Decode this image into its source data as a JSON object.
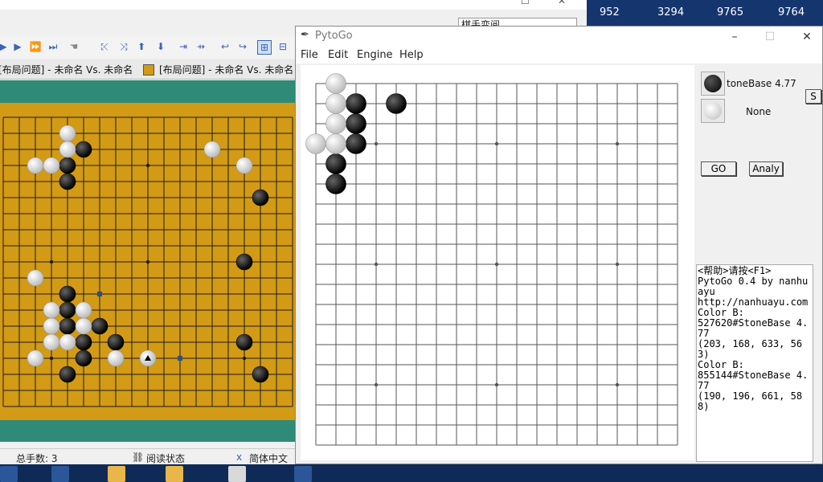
{
  "desktop": {
    "counters": [
      "952",
      "3294",
      "9765",
      "9764"
    ]
  },
  "bg_app": {
    "combo_value": "棋手变阅",
    "tabs": [
      "[布局问题] - 未命名 Vs. 未命名",
      "[布局问题] - 未命名 Vs. 未命名"
    ],
    "status": {
      "moves": "总手数: 3",
      "mode": "阅读状态",
      "lang": "简体中文"
    }
  },
  "pytogo": {
    "title": "PytoGo",
    "menu": [
      "File",
      "Edit",
      "Engine",
      "Help"
    ],
    "black_engine": "toneBase 4.77",
    "white_engine": "None",
    "s_button": "S",
    "go_button": "GO",
    "analy_button": "Analy",
    "log": "<帮助>请按<F1>\nPytoGo 0.4 by nanhuayu\nhttp://nanhuayu.com\nColor B:\n527620#StoneBase 4.77\n(203, 168, 633, 563)\nColor B:\n855144#StoneBase 4.77\n(190, 196, 661, 588)",
    "board": {
      "size": 19,
      "black": [
        [
          2,
          1
        ],
        [
          2,
          2
        ],
        [
          2,
          3
        ],
        [
          1,
          4
        ],
        [
          1,
          5
        ],
        [
          4,
          1
        ]
      ],
      "white": [
        [
          1,
          0
        ],
        [
          1,
          1
        ],
        [
          1,
          2
        ],
        [
          1,
          3
        ],
        [
          0,
          3
        ]
      ]
    }
  },
  "bg_board": {
    "black": [
      [
        5,
        2
      ],
      [
        4,
        3
      ],
      [
        4,
        4
      ],
      [
        16,
        5
      ],
      [
        15,
        9
      ],
      [
        4,
        11
      ],
      [
        4,
        12
      ],
      [
        4,
        13
      ],
      [
        6,
        13
      ],
      [
        5,
        14
      ],
      [
        5,
        15
      ],
      [
        7,
        14
      ],
      [
        15,
        14
      ],
      [
        4,
        16
      ],
      [
        16,
        16
      ]
    ],
    "white": [
      [
        4,
        1
      ],
      [
        4,
        2
      ],
      [
        2,
        3
      ],
      [
        3,
        3
      ],
      [
        13,
        2
      ],
      [
        15,
        3
      ],
      [
        2,
        10
      ],
      [
        3,
        12
      ],
      [
        3,
        13
      ],
      [
        5,
        12
      ],
      [
        5,
        13
      ],
      [
        3,
        14
      ],
      [
        4,
        14
      ],
      [
        2,
        15
      ],
      [
        7,
        15
      ],
      [
        9,
        15
      ]
    ],
    "marks": [
      [
        6,
        11
      ],
      [
        11,
        15
      ]
    ],
    "last_move": [
      9,
      15
    ]
  },
  "icons": {
    "feather": "feather-icon",
    "minimize": "minimize-icon",
    "maximize": "maximize-icon",
    "close": "close-icon"
  }
}
